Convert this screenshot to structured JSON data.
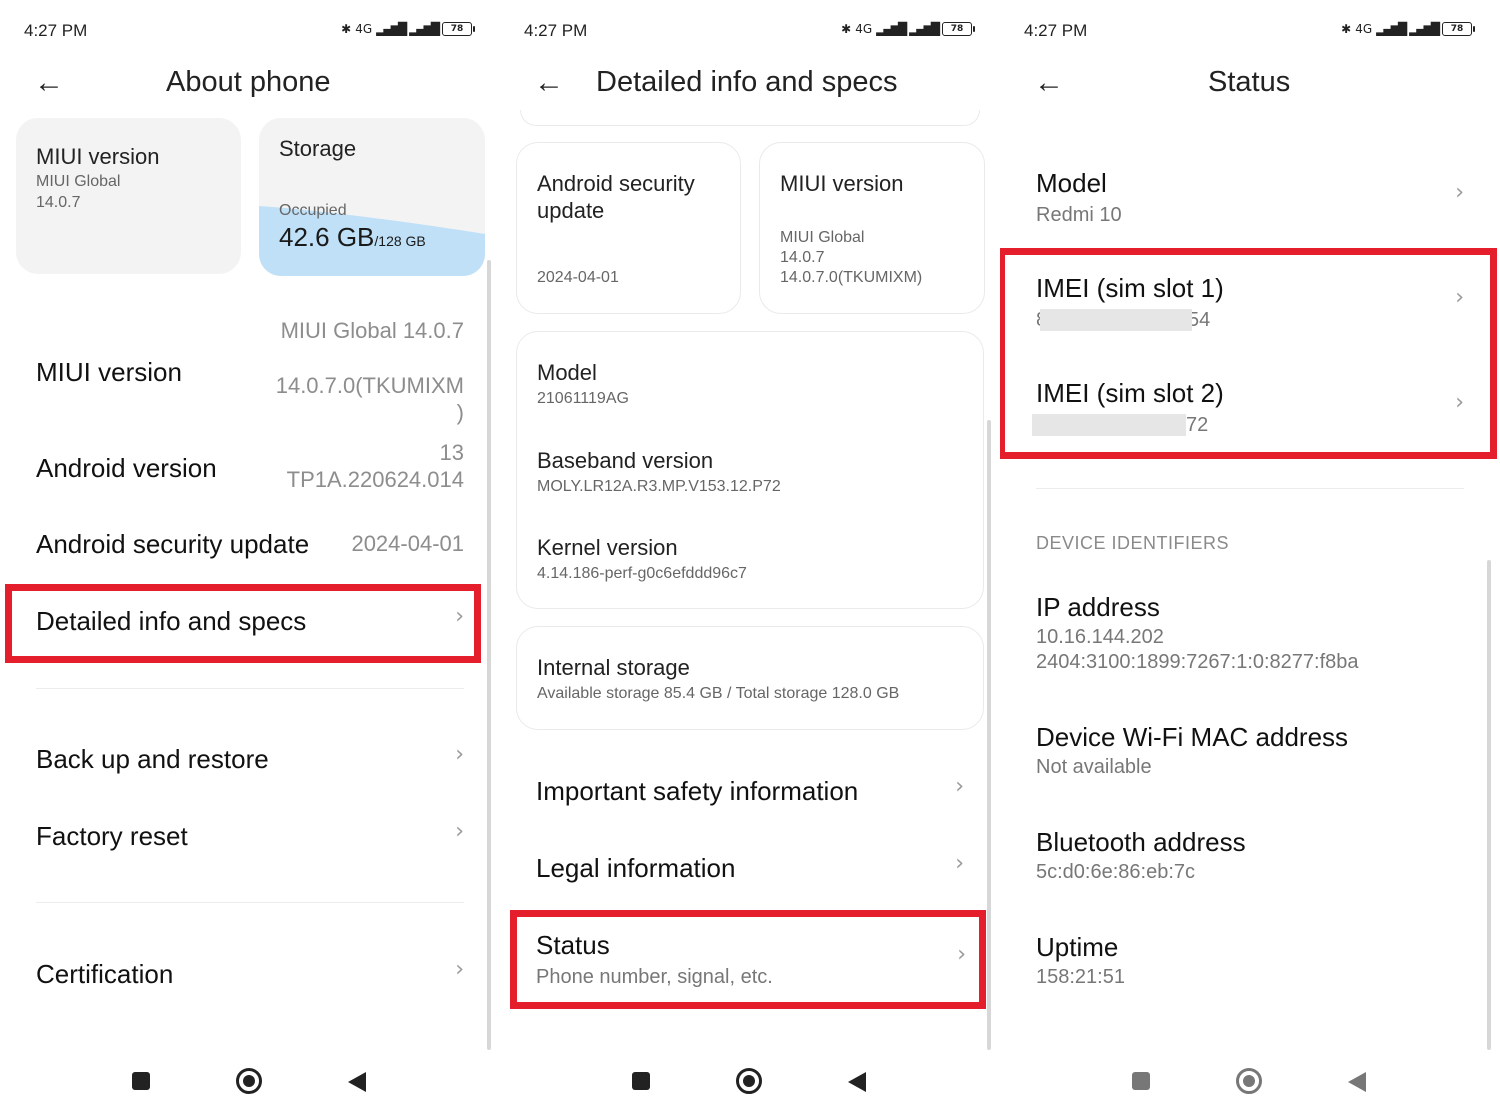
{
  "status_bar": {
    "time": "4:27 PM",
    "network": "4G",
    "battery": "78"
  },
  "screen1": {
    "title": "About phone",
    "card_miui": {
      "title": "MIUI version",
      "line1": "MIUI Global",
      "line2": "14.0.7"
    },
    "card_storage": {
      "title": "Storage",
      "occupied_label": "Occupied",
      "used": "42.6 GB",
      "total": "/128 GB"
    },
    "rows": {
      "miui_label": "MIUI version",
      "miui_value1": "MIUI Global 14.0.7",
      "miui_value2": "14.0.7.0(TKUMIXM",
      "miui_value3": ")",
      "android_label": "Android version",
      "android_value1": "13",
      "android_value2": "TP1A.220624.014",
      "security_label": "Android security update",
      "security_value": "2024-04-01",
      "detailed_label": "Detailed info and specs",
      "backup_label": "Back up and restore",
      "factory_label": "Factory reset",
      "cert_label": "Certification"
    }
  },
  "screen2": {
    "title": "Detailed info and specs",
    "card_security": {
      "title1": "Android security",
      "title2": "update",
      "value": "2024-04-01"
    },
    "card_miui": {
      "title": "MIUI version",
      "line1": "MIUI Global",
      "line2": "14.0.7",
      "line3": "14.0.7.0(TKUMIXM)"
    },
    "model": {
      "label": "Model",
      "value": "21061119AG"
    },
    "baseband": {
      "label": "Baseband version",
      "value": "MOLY.LR12A.R3.MP.V153.12.P72"
    },
    "kernel": {
      "label": "Kernel version",
      "value": "4.14.186-perf-g0c6efddd96c7"
    },
    "storage": {
      "label": "Internal storage",
      "value": "Available storage  85.4 GB / Total storage  128.0 GB"
    },
    "safety_label": "Important safety information",
    "legal_label": "Legal information",
    "status": {
      "label": "Status",
      "sub": "Phone number, signal, etc."
    }
  },
  "screen3": {
    "title": "Status",
    "model": {
      "label": "Model",
      "value": "Redmi 10"
    },
    "imei1": {
      "label": "IMEI (sim slot 1)",
      "value_start": "8",
      "value_end": "54"
    },
    "imei2": {
      "label": "IMEI (sim slot 2)",
      "value_end": "72"
    },
    "section_header": "DEVICE IDENTIFIERS",
    "ip": {
      "label": "IP address",
      "value1": "10.16.144.202",
      "value2": "2404:3100:1899:7267:1:0:8277:f8ba"
    },
    "wifi_mac": {
      "label": "Device Wi-Fi MAC address",
      "value": "Not available"
    },
    "bt": {
      "label": "Bluetooth address",
      "value": "5c:d0:6e:86:eb:7c"
    },
    "uptime": {
      "label": "Uptime",
      "value": "158:21:51"
    }
  },
  "icons": {
    "back": "←",
    "chevron": "›",
    "bluetooth": "✱"
  },
  "colors": {
    "highlight": "#e41e2b",
    "storage_fill": "#bfe0f7"
  }
}
